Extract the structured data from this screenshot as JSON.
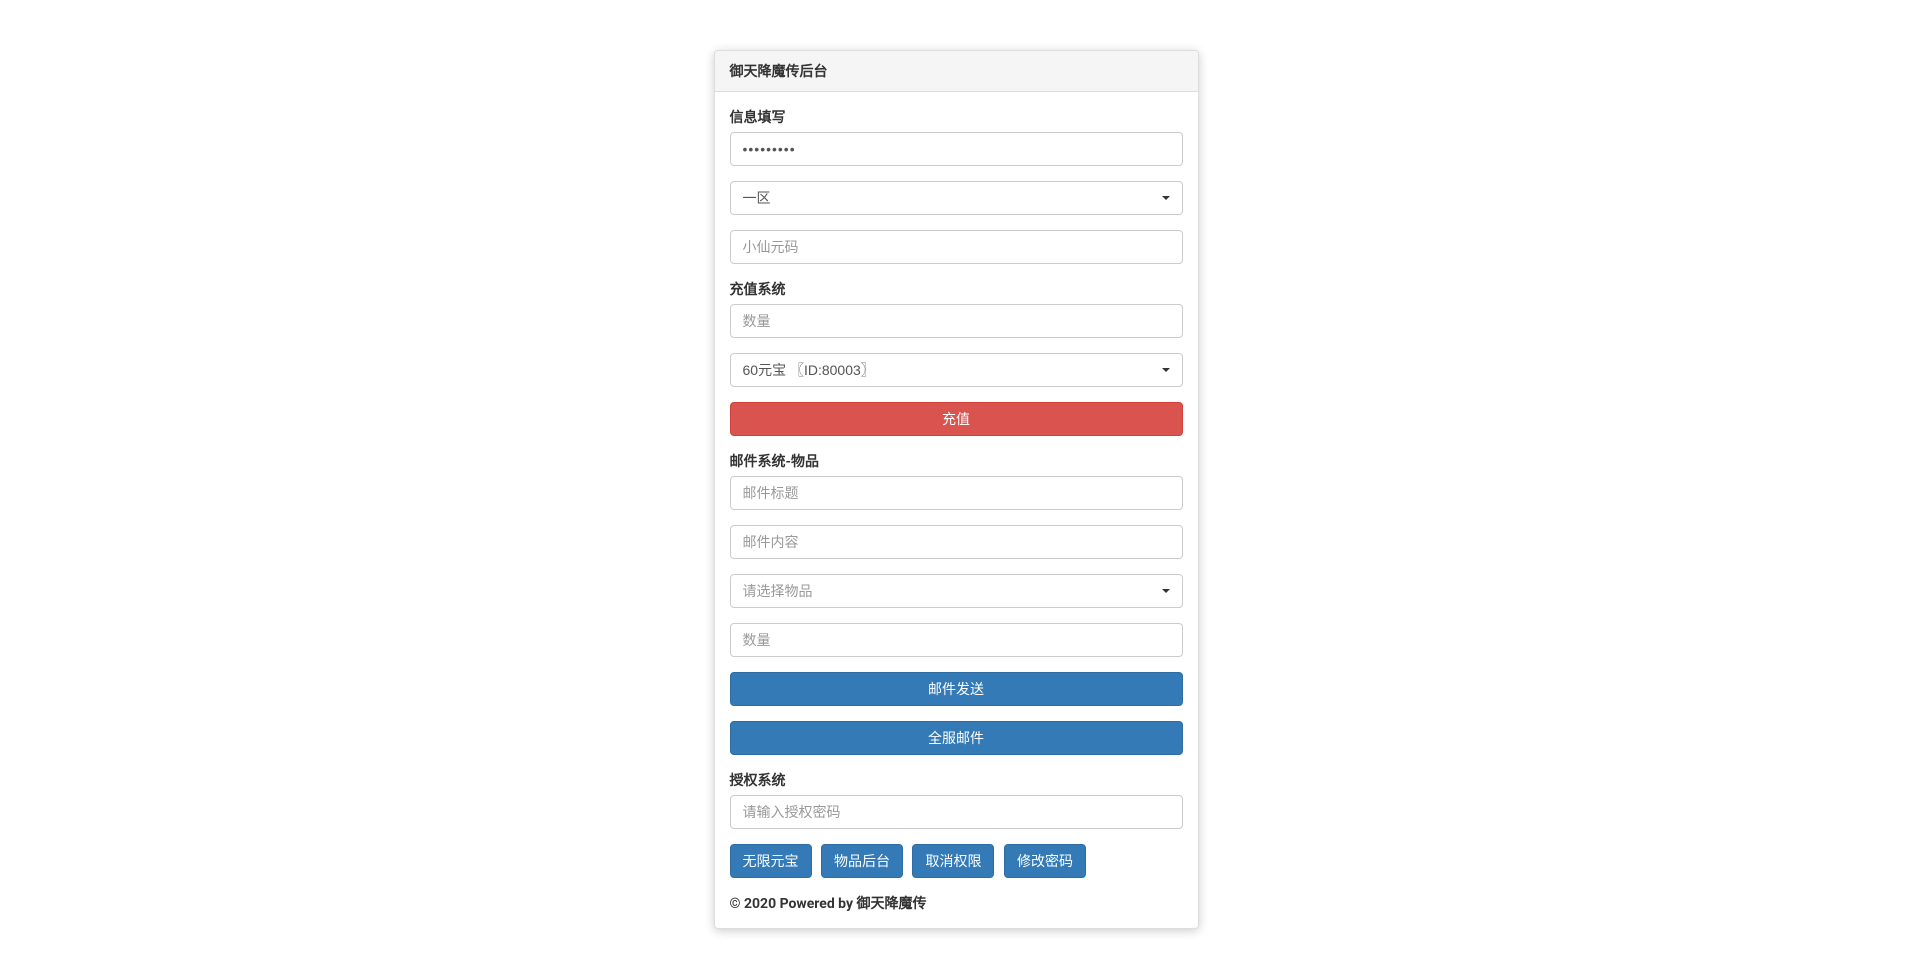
{
  "panel": {
    "title": "御天降魔传后台"
  },
  "info": {
    "label": "信息填写",
    "password_value": "•••••••••",
    "zone_selected": "一区",
    "code_placeholder": "小仙元码"
  },
  "recharge": {
    "label": "充值系统",
    "qty_placeholder": "数量",
    "item_selected": "60元宝 〖ID:80003〗",
    "button": "充值"
  },
  "mail": {
    "label": "邮件系统-物品",
    "title_placeholder": "邮件标题",
    "content_placeholder": "邮件内容",
    "item_placeholder": "请选择物品",
    "qty_placeholder": "数量",
    "send_button": "邮件发送",
    "broadcast_button": "全服邮件"
  },
  "auth": {
    "label": "授权系统",
    "pwd_placeholder": "请输入授权密码",
    "btn_unlimited": "无限元宝",
    "btn_item_admin": "物品后台",
    "btn_revoke": "取消权限",
    "btn_changepwd": "修改密码"
  },
  "footer": {
    "copyright": "© 2020 Powered by 御天降魔传"
  }
}
